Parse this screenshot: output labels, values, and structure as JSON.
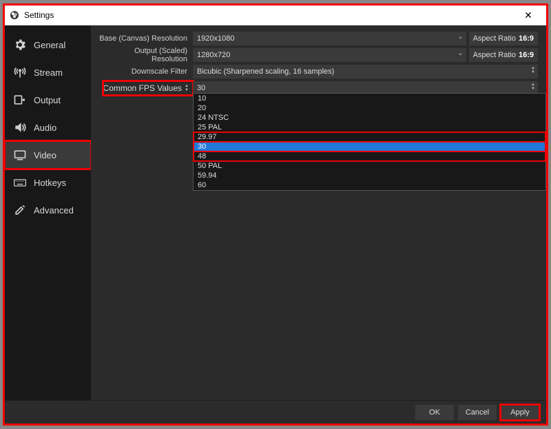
{
  "window": {
    "title": "Settings"
  },
  "sidebar": {
    "items": [
      {
        "label": "General"
      },
      {
        "label": "Stream"
      },
      {
        "label": "Output"
      },
      {
        "label": "Audio"
      },
      {
        "label": "Video"
      },
      {
        "label": "Hotkeys"
      },
      {
        "label": "Advanced"
      }
    ]
  },
  "fields": {
    "base_label": "Base (Canvas) Resolution",
    "base_value": "1920x1080",
    "output_label": "Output (Scaled) Resolution",
    "output_value": "1280x720",
    "downscale_label": "Downscale Filter",
    "downscale_value": "Bicubic (Sharpened scaling, 16 samples)",
    "fps_label": "Common FPS Values",
    "fps_value": "30",
    "aspect_label": "Aspect Ratio",
    "aspect_value": "16:9"
  },
  "fps_options": [
    "10",
    "20",
    "24 NTSC",
    "25 PAL",
    "29.97",
    "30",
    "48",
    "50 PAL",
    "59.94",
    "60"
  ],
  "footer": {
    "ok": "OK",
    "cancel": "Cancel",
    "apply": "Apply"
  }
}
